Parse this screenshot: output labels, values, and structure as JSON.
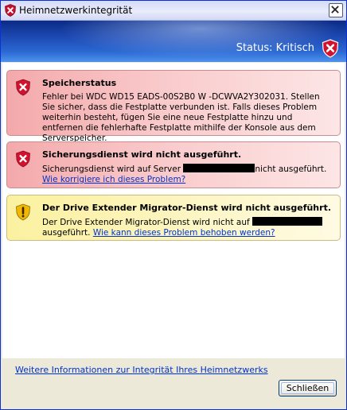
{
  "window": {
    "title": "Heimnetzwerkintegrität"
  },
  "header": {
    "status": "Status: Kritisch"
  },
  "colors": {
    "critical": "#c8102e",
    "warning": "#f2b705",
    "link": "#0033cc"
  },
  "alerts": [
    {
      "severity": "critical",
      "icon": "shield-x-icon",
      "title": "Speicherstatus",
      "body": "Fehler bei WDC WD15 EADS-00S2B0     W -DCWVA2Y302031. Stellen Sie sicher, dass die Festplatte verbunden ist. Falls dieses Problem weiterhin besteht, fügen Sie eine neue Festplatte hinzu und entfernen die fehlerhafte Festplatte mithilfe der Konsole aus dem Serverspeicher."
    },
    {
      "severity": "critical",
      "icon": "shield-x-icon",
      "title": "Sicherungsdienst wird nicht ausgeführt.",
      "body_before": "Sicherungsdienst wird auf Server ",
      "body_after": "nicht ausgeführt. ",
      "link": "Wie korrigiere ich dieses Problem?"
    },
    {
      "severity": "warning",
      "icon": "shield-exclamation-icon",
      "title": "Der Drive Extender Migrator-Dienst wird nicht ausgeführt.",
      "body_before": "Der Drive Extender Migrator-Dienst wird nicht auf ",
      "body_after": " ausgeführt. ",
      "link": "Wie kann dieses Problem behoben werden?"
    }
  ],
  "footer": {
    "more_info_link": "Weitere Informationen zur Integrität Ihres Heimnetzwerks",
    "close_button": "Schließen"
  }
}
